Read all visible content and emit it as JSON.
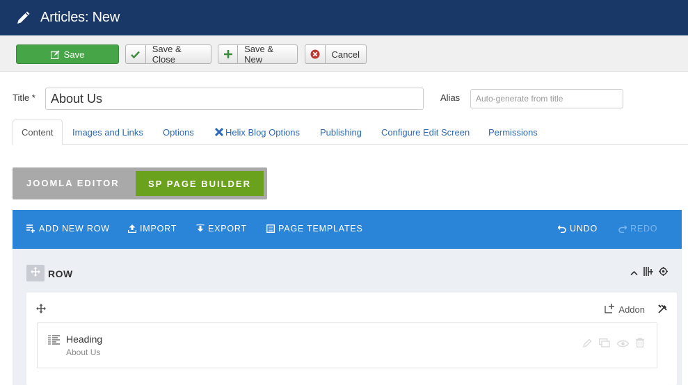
{
  "header": {
    "title": "Articles: New",
    "icon": "pencil-icon"
  },
  "toolbar": {
    "save_label": "Save",
    "save_close_label": "Save & Close",
    "save_new_label": "Save & New",
    "cancel_label": "Cancel"
  },
  "form": {
    "title_label": "Title *",
    "title_value": "About Us",
    "alias_label": "Alias",
    "alias_placeholder": "Auto-generate from title"
  },
  "tabs": [
    {
      "label": "Content",
      "active": true
    },
    {
      "label": "Images and Links"
    },
    {
      "label": "Options"
    },
    {
      "label": "Helix Blog Options"
    },
    {
      "label": "Publishing"
    },
    {
      "label": "Configure Edit Screen"
    },
    {
      "label": "Permissions"
    }
  ],
  "editor_switch": {
    "joomla": "JOOMLA EDITOR",
    "sp": "SP PAGE BUILDER"
  },
  "builder_bar": {
    "add_new_row": "ADD NEW ROW",
    "import": "IMPORT",
    "export": "EXPORT",
    "page_templates": "PAGE TEMPLATES",
    "undo": "UNDO",
    "redo": "REDO"
  },
  "row": {
    "label": "ROW"
  },
  "column": {
    "addon_label": "Addon"
  },
  "addon": {
    "name": "Heading",
    "subtitle": "About Us"
  },
  "colors": {
    "header_bg": "#1a3867",
    "save_green": "#46a546",
    "builder_blue": "#2a85d9",
    "sp_green": "#6aa11d",
    "link_blue": "#2a69b8"
  }
}
